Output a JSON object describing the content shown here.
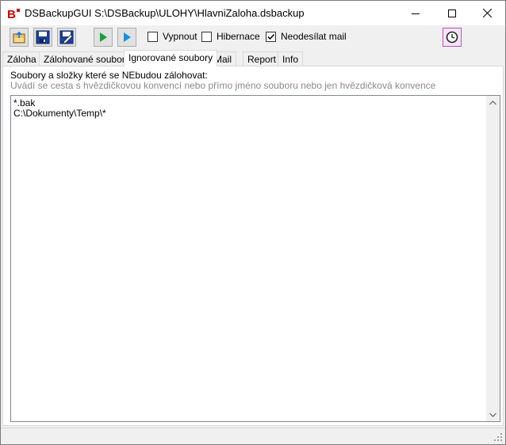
{
  "window": {
    "title": "DSBackupGUI S:\\DSBackup\\ULOHY\\HlavniZaloha.dsbackup",
    "logo_text": "B",
    "accent": "#d40000"
  },
  "titlebar_buttons": [
    {
      "name": "minimize-icon"
    },
    {
      "name": "maximize-icon"
    },
    {
      "name": "close-icon"
    }
  ],
  "toolbar": {
    "icons": [
      "open-icon",
      "save-icon",
      "save-as-icon",
      "run-icon",
      "run-step-icon",
      "schedule-clock-icon"
    ],
    "checkboxes": [
      {
        "label": "Vypnout",
        "checked": false
      },
      {
        "label": "Hibernace",
        "checked": false
      },
      {
        "label": "Neodesílat mail",
        "checked": true
      }
    ]
  },
  "tabs": [
    {
      "label": "Záloha",
      "active": false
    },
    {
      "label": "Zálohované soubory",
      "active": false
    },
    {
      "label": "Ignorované soubory",
      "active": true
    },
    {
      "label": "Mail",
      "active": false
    },
    {
      "label": "Report",
      "active": false
    },
    {
      "label": "Info",
      "active": false
    }
  ],
  "ignored": {
    "heading": "Soubory a složky které se NEbudou zálohovat:",
    "hint": "Uvádí se cesta s hvězdičkovou konvencí nebo přímo jméno souboru nebo jen hvězdičková konvence",
    "lines": "*.bak\nC:\\Dokumenty\\Temp\\*"
  }
}
